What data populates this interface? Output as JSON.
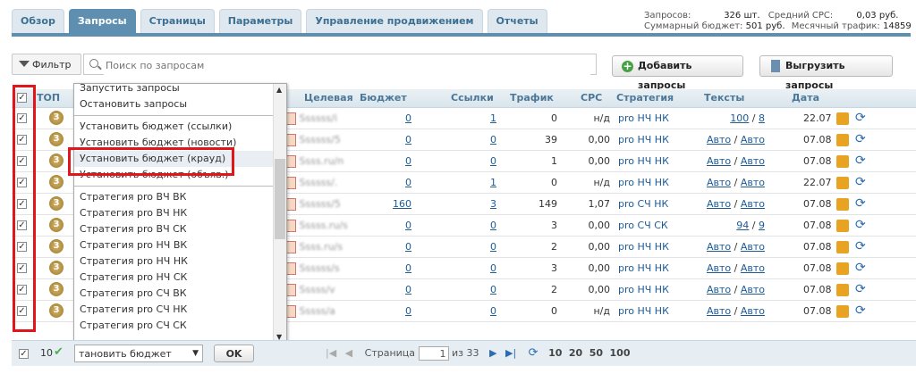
{
  "tabs": [
    "Обзор",
    "Запросы",
    "Страницы",
    "Параметры",
    "Управление продвижением",
    "Отчеты"
  ],
  "stats": {
    "queries_label": "Запросов:",
    "queries_value": "326 шт.",
    "avg_cpc_label": "Средний CPC:",
    "avg_cpc_value": "0,03 руб.",
    "budget_label": "Суммарный бюджет:",
    "budget_value": "501 руб.",
    "traffic_label": "Месячный трафик:",
    "traffic_value": "14859"
  },
  "toolbar": {
    "filter_label": "Фильтр",
    "search_placeholder": "Поиск по запросам",
    "add_label": "Добавить запросы",
    "export_label": "Выгрузить запросы"
  },
  "columns": {
    "top": "ТОП",
    "target": "Целевая",
    "budget": "Бюджет",
    "links": "Ссылки",
    "traffic": "Трафик",
    "cpc": "CPC",
    "strategy": "Стратегия",
    "texts": "Тексты",
    "date": "Дата"
  },
  "rows": [
    {
      "rank": "3",
      "url": "Ssssss/i",
      "budget": "0",
      "links": "1",
      "traffic": "0",
      "cpc": "н/д",
      "strategy": "pro НЧ НК",
      "t1": "100",
      "t2": "8",
      "date": "22.07"
    },
    {
      "rank": "3",
      "url": "Ssssss/5",
      "budget": "0",
      "links": "0",
      "traffic": "39",
      "cpc": "0,00",
      "strategy": "pro НЧ НК",
      "t1": "Авто",
      "t2": "Авто",
      "date": "07.08"
    },
    {
      "rank": "3",
      "url": "Ssss.ru/n",
      "budget": "0",
      "links": "0",
      "traffic": "1",
      "cpc": "0,00",
      "strategy": "pro НЧ НК",
      "t1": "Авто",
      "t2": "Авто",
      "date": "07.08"
    },
    {
      "rank": "3",
      "url": "Ssssss/.",
      "budget": "0",
      "links": "1",
      "traffic": "0",
      "cpc": "н/д",
      "strategy": "pro НЧ НК",
      "t1": "Авто",
      "t2": "Авто",
      "date": "22.07"
    },
    {
      "rank": "3",
      "url": "Ssssss/5",
      "budget": "160",
      "links": "3",
      "traffic": "149",
      "cpc": "1,07",
      "strategy": "pro СЧ НК",
      "t1": "Авто",
      "t2": "Авто",
      "date": "07.08"
    },
    {
      "rank": "3",
      "url": "Sssss.ru/s",
      "budget": "0",
      "links": "0",
      "traffic": "3",
      "cpc": "0,00",
      "strategy": "pro СЧ СК",
      "t1": "94",
      "t2": "9",
      "date": "07.08"
    },
    {
      "rank": "3",
      "url": "Ssss.ru/s",
      "budget": "0",
      "links": "0",
      "traffic": "2",
      "cpc": "0,00",
      "strategy": "pro НЧ НК",
      "t1": "Авто",
      "t2": "Авто",
      "date": "07.08"
    },
    {
      "rank": "3",
      "url": "Ssssss/s",
      "budget": "0",
      "links": "0",
      "traffic": "3",
      "cpc": "0,00",
      "strategy": "pro НЧ НК",
      "t1": "Авто",
      "t2": "Авто",
      "date": "07.08"
    },
    {
      "rank": "3",
      "url": "Sssss/v",
      "budget": "0",
      "links": "0",
      "traffic": "2",
      "cpc": "0,00",
      "strategy": "pro НЧ НК",
      "t1": "Авто",
      "t2": "Авто",
      "date": "07.08"
    },
    {
      "rank": "3",
      "url": "Sssss/a",
      "budget": "0",
      "links": "0",
      "traffic": "0",
      "cpc": "н/д",
      "strategy": "pro НЧ НК",
      "t1": "Авто",
      "t2": "Авто",
      "date": "07.08"
    }
  ],
  "dropdown": {
    "group1": [
      "Запустить запросы",
      "Остановить запросы"
    ],
    "group2": [
      "Установить бюджет (ссылки)",
      "Установить бюджет (новости)",
      "Установить бюджет (крауд)",
      "Установить бюджет (объяв.)"
    ],
    "group3": [
      "Стратегия pro ВЧ ВК",
      "Стратегия pro ВЧ НК",
      "Стратегия pro ВЧ СК",
      "Стратегия pro НЧ ВК",
      "Стратегия pro НЧ НК",
      "Стратегия pro НЧ СК",
      "Стратегия pro СЧ ВК",
      "Стратегия pro СЧ НК",
      "Стратегия pro СЧ СК"
    ]
  },
  "footer": {
    "count": "10",
    "selected_action": "тановить бюджет (крауд)",
    "ok_label": "OK",
    "page_label": "Страница",
    "page_value": "1",
    "of_label": "из 33",
    "per_page": [
      "10",
      "20",
      "50",
      "100"
    ]
  }
}
